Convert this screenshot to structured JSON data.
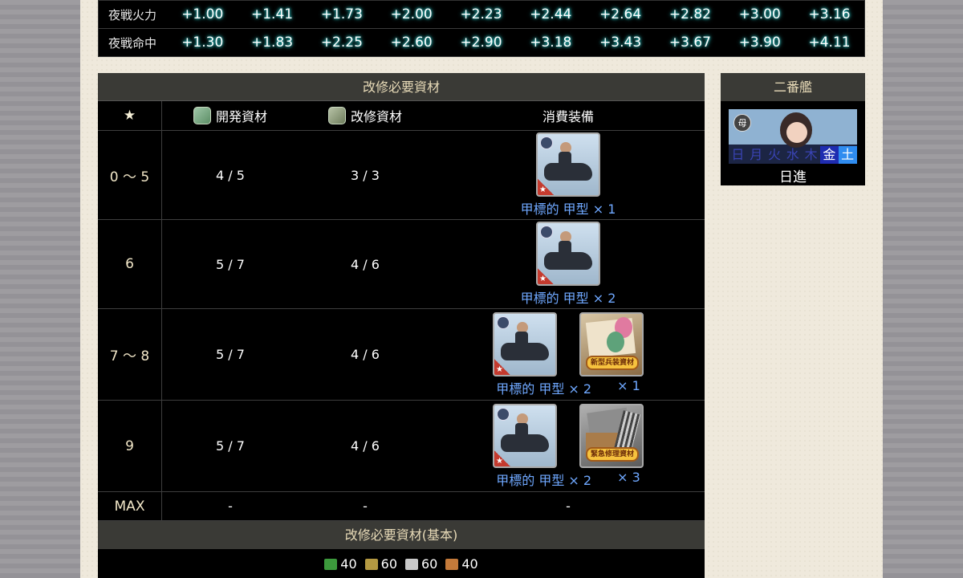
{
  "stats": {
    "rows": [
      {
        "label": "夜戦火力",
        "values": [
          "+1.00",
          "+1.41",
          "+1.73",
          "+2.00",
          "+2.23",
          "+2.44",
          "+2.64",
          "+2.82",
          "+3.00",
          "+3.16"
        ]
      },
      {
        "label": "夜戦命中",
        "values": [
          "+1.30",
          "+1.83",
          "+2.25",
          "+2.60",
          "+2.90",
          "+3.18",
          "+3.43",
          "+3.67",
          "+3.90",
          "+4.11"
        ]
      }
    ]
  },
  "remodel": {
    "title": "改修必要資材",
    "headers": {
      "star": "★",
      "dev": "開発資材",
      "imp": "改修資材",
      "equip": "消費装備"
    },
    "rows": [
      {
        "star": "0 ～ 5",
        "dev": "4 / 5",
        "imp": "3 / 3",
        "equip_name": "甲標的 甲型 × 1",
        "has_material": false
      },
      {
        "star": "6",
        "dev": "5 / 7",
        "imp": "4 / 6",
        "equip_name": "甲標的 甲型 × 2",
        "has_material": false
      },
      {
        "star": "7 ～ 8",
        "dev": "5 / 7",
        "imp": "4 / 6",
        "equip_name": "甲標的 甲型 × 2",
        "material_qty": "× 1",
        "material_badge": "新型兵装資材"
      },
      {
        "star": "9",
        "dev": "5 / 7",
        "imp": "4 / 6",
        "equip_name": "甲標的 甲型 × 2",
        "material_qty": "× 3",
        "material_badge": "緊急修理資材"
      },
      {
        "star": "MAX",
        "dev": "-",
        "imp": "-",
        "equip": "-"
      }
    ],
    "basic_title": "改修必要資材(基本)",
    "basic": {
      "fuel": "40",
      "ammo": "60",
      "steel": "60",
      "baux": "40"
    }
  },
  "second": {
    "title": "二番艦",
    "ship_type": "母",
    "days": [
      "日",
      "月",
      "火",
      "水",
      "木",
      "金",
      "土"
    ],
    "name": "日進"
  },
  "colors": {
    "accent_blue": "#6fa8ff",
    "glow": "#2fd0d0"
  }
}
